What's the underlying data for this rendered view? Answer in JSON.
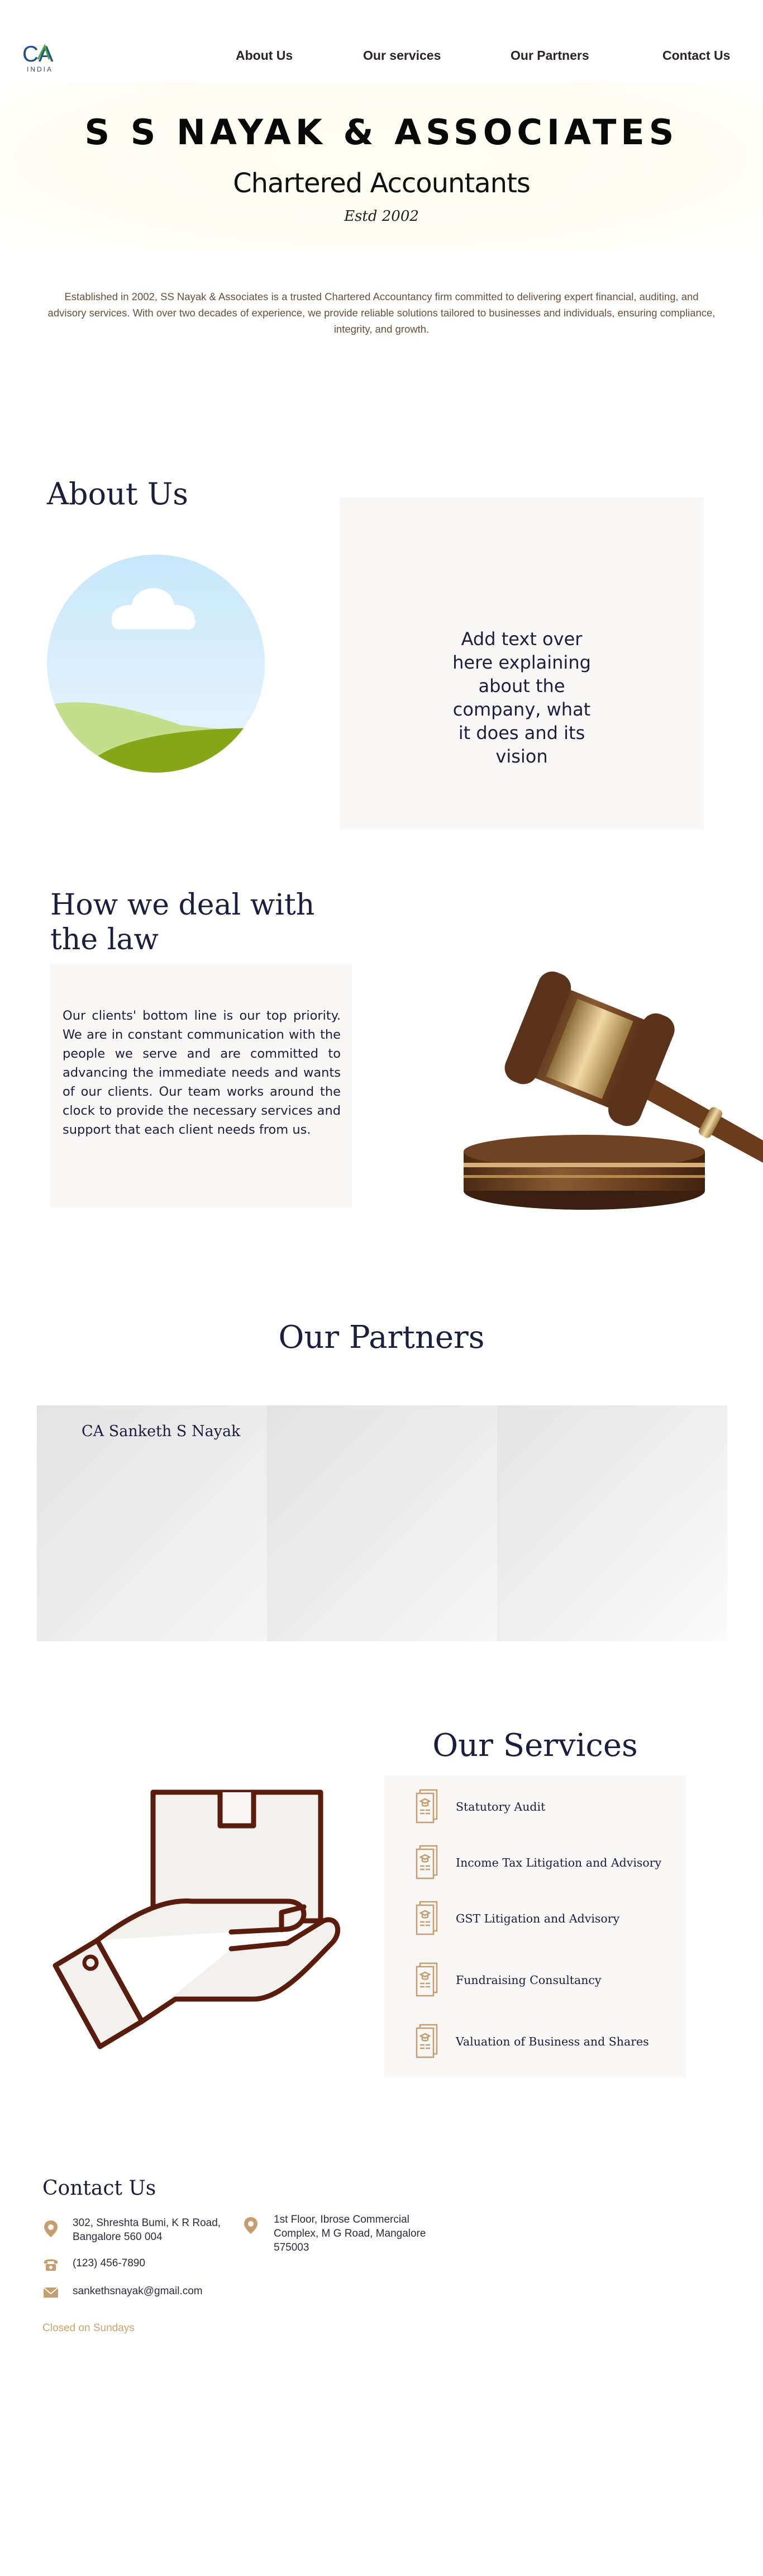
{
  "header": {
    "logo_text": "CA",
    "logo_subtext": "INDIA",
    "nav": [
      {
        "label": "About Us"
      },
      {
        "label": "Our services"
      },
      {
        "label": "Our  Partners"
      },
      {
        "label": "Contact Us"
      }
    ]
  },
  "hero": {
    "title": "S S NAYAK & ASSOCIATES",
    "subtitle": "Chartered Accountants",
    "established": "Estd 2002"
  },
  "intro": "Established in 2002, SS Nayak & Associates is a trusted Chartered Accountancy firm committed to delivering expert financial, auditing, and advisory services. With over two decades of experience, we provide reliable solutions tailored to businesses and individuals, ensuring compliance, integrity, and growth.",
  "about": {
    "title": "About Us",
    "card_text": "Add text over here explaining about the company, what it does and its vision"
  },
  "law": {
    "title": "How we deal with the law",
    "text": "Our clients' bottom line is our top priority. We are in constant communication with the people we serve and are committed to advancing the immediate needs and wants of our clients. Our team works around the clock to provide the necessary services and support that each client needs from us."
  },
  "partners": {
    "title": "Our Partners",
    "cards": [
      {
        "name": "CA Sanketh S Nayak"
      },
      {
        "name": ""
      },
      {
        "name": ""
      }
    ]
  },
  "services": {
    "title": "Our Services",
    "items": [
      {
        "label": "Statutory Audit"
      },
      {
        "label": "Income Tax  Litigation and Advisory"
      },
      {
        "label": "GST Litigation and Advisory"
      },
      {
        "label": "Fundraising Consultancy"
      },
      {
        "label": "Valuation of Business and Shares"
      }
    ]
  },
  "contact": {
    "title": "Contact Us",
    "address_1": [
      "302, Shreshta Bumi, K R Road,",
      "Bangalore 560 004"
    ],
    "address_2": [
      "1st Floor, Ibrose Commercial",
      "Complex, M G Road, Mangalore",
      "575003"
    ],
    "phone": "(123) 456-7890",
    "email": "sankethsnayak@gmail.com",
    "hours_note": "Closed on Sundays"
  },
  "colors": {
    "navy": "#1c1d3f",
    "card_bg": "#f8f7f5",
    "gold_icon": "#c59d6e",
    "brown_outline": "#5a1d0d"
  }
}
